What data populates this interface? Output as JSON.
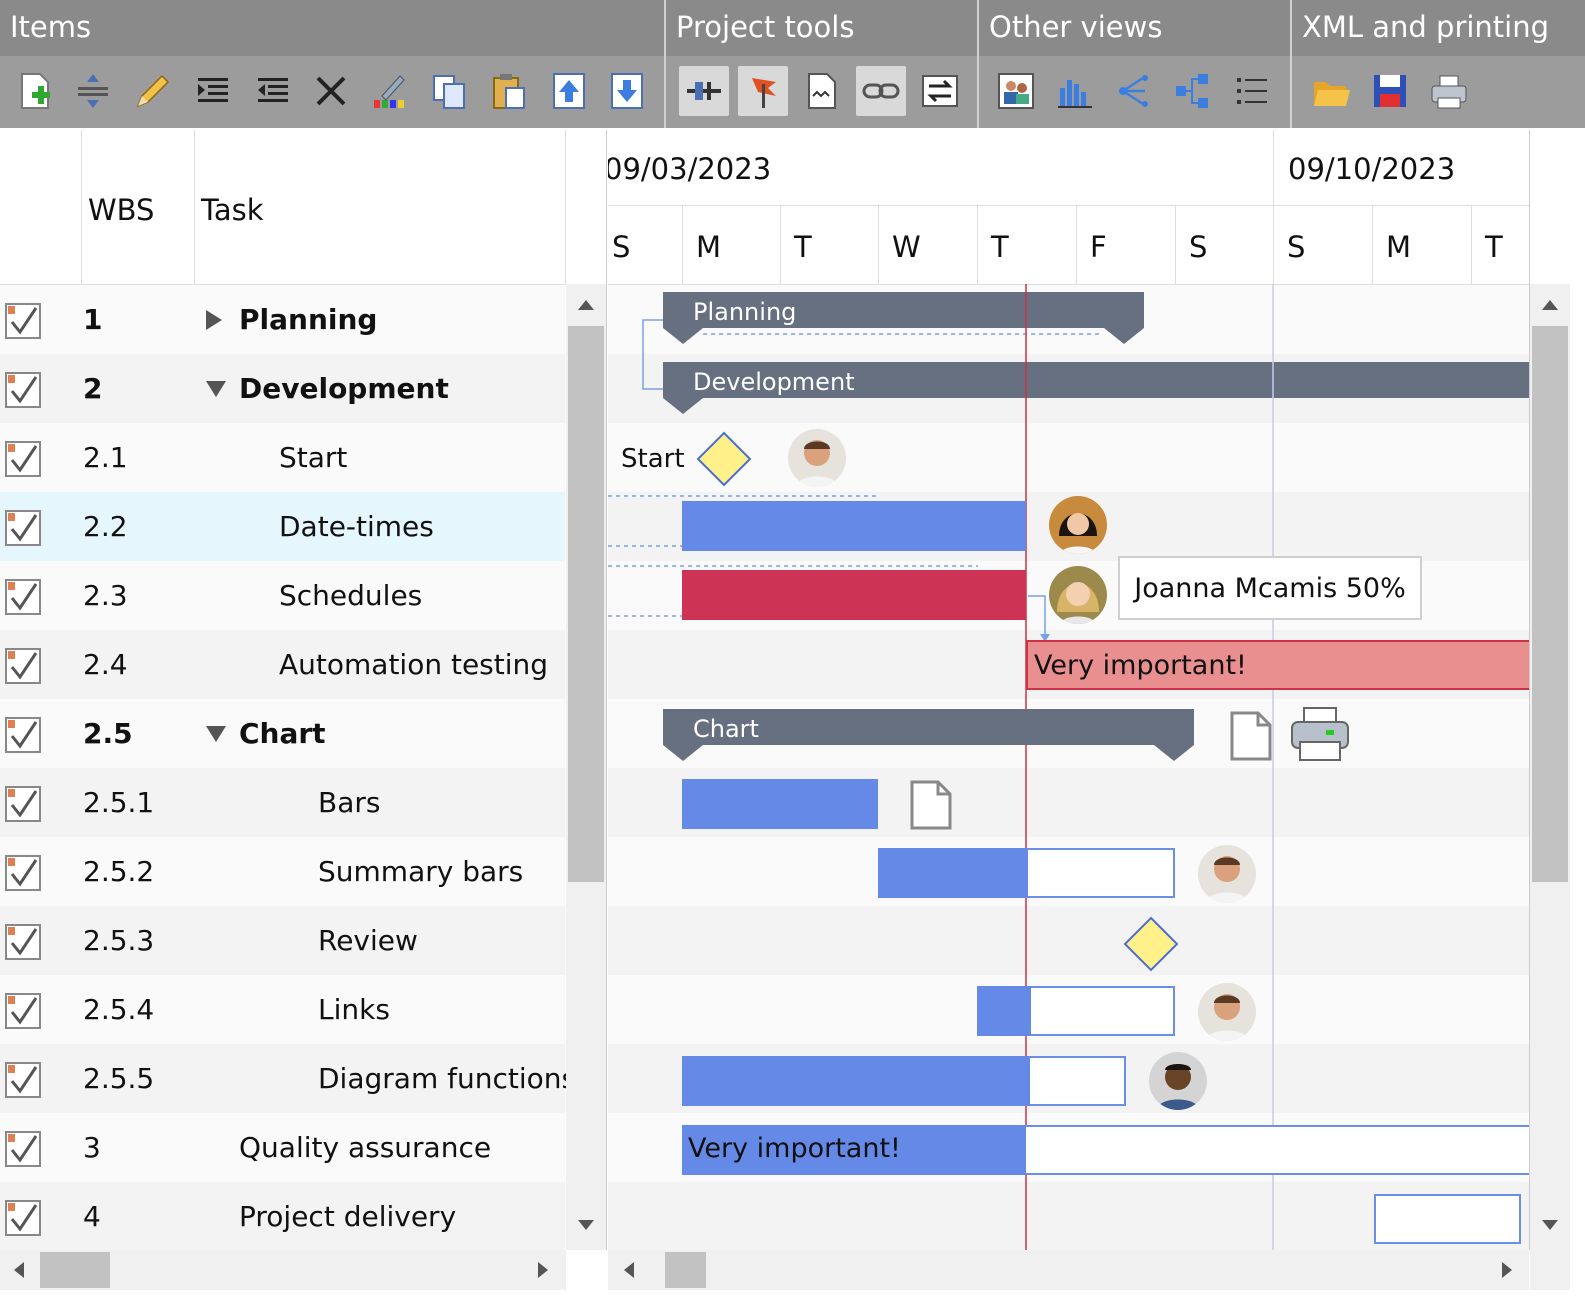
{
  "ribbon": {
    "groups": [
      {
        "title": "Items"
      },
      {
        "title": "Project tools"
      },
      {
        "title": "Other views"
      },
      {
        "title": "XML and printing"
      }
    ],
    "buttons": {
      "add_item": "add-item-icon",
      "insert_item": "insert-item-icon",
      "edit_item": "edit-item-icon",
      "indent_item": "increase-indent-icon",
      "outdent_item": "decrease-indent-icon",
      "delete_item": "delete-icon",
      "format_item": "format-icon",
      "copy": "copy-icon",
      "paste": "paste-icon",
      "move_up": "move-up-icon",
      "move_down": "move-down-icon",
      "level_schedule": "schedule-icon",
      "baseline": "baseline-flag-icon",
      "project_statistics": "statistics-icon",
      "link_items": "link-icon",
      "swap": "swap-icon",
      "resources_view": "resources-icon",
      "load_chart": "load-chart-icon",
      "pert_view": "pert-network-icon",
      "hierarchy_view": "hierarchy-icon",
      "list_view": "list-icon",
      "open_xml": "open-folder-icon",
      "save_xml": "save-icon",
      "print": "print-icon"
    }
  },
  "grid": {
    "columns": {
      "wbs": "WBS",
      "task": "Task"
    },
    "rows": [
      {
        "wbs": "1",
        "task": "Planning",
        "summary": true,
        "expanded": false
      },
      {
        "wbs": "2",
        "task": "Development",
        "summary": true,
        "expanded": true
      },
      {
        "wbs": "2.1",
        "task": "Start"
      },
      {
        "wbs": "2.2",
        "task": "Date-times",
        "selected": true
      },
      {
        "wbs": "2.3",
        "task": "Schedules"
      },
      {
        "wbs": "2.4",
        "task": "Automation testing"
      },
      {
        "wbs": "2.5",
        "task": "Chart",
        "summary": true,
        "expanded": true
      },
      {
        "wbs": "2.5.1",
        "task": "Bars"
      },
      {
        "wbs": "2.5.2",
        "task": "Summary bars"
      },
      {
        "wbs": "2.5.3",
        "task": "Review"
      },
      {
        "wbs": "2.5.4",
        "task": "Links"
      },
      {
        "wbs": "2.5.5",
        "task": "Diagram functions"
      },
      {
        "wbs": "3",
        "task": "Quality assurance"
      },
      {
        "wbs": "4",
        "task": "Project delivery"
      }
    ]
  },
  "timeline": {
    "weeks": [
      "09/03/2023",
      "09/10/2023"
    ],
    "days": [
      "S",
      "M",
      "T",
      "W",
      "T",
      "F",
      "S",
      "S",
      "M",
      "T"
    ]
  },
  "chart": {
    "summary_labels": {
      "planning": "Planning",
      "development": "Development",
      "chart": "Chart"
    },
    "milestone_label": "Start",
    "important_label_1": "Very important!",
    "important_label_2": "Very important!",
    "tooltip": "Joanna Mcamis 50%",
    "colors": {
      "bar": "#6589e6",
      "critical": "#cc3355",
      "important": "#e98f8f",
      "summary": "#667080",
      "milestone": "#fff08a",
      "current_time": "#cc3344"
    }
  }
}
